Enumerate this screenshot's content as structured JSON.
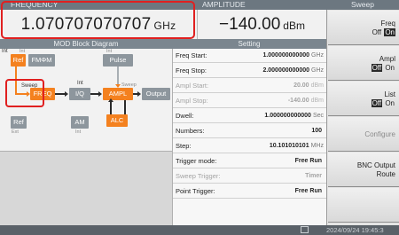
{
  "frequency": {
    "header": "FREQUENCY",
    "value": "1.070707070707",
    "unit": "GHz"
  },
  "amplitude": {
    "header": "AMPLITUDE",
    "value": "−140.00",
    "unit": "dBm"
  },
  "diagram": {
    "title": "MOD Block Diagram",
    "blocks": {
      "ref_top": "Ref",
      "fm_phim": "FMΦM",
      "pulse": "Pulse",
      "freq": "FREQ",
      "iq": "I/Q",
      "ampl": "AMPL",
      "output": "Output",
      "ref_bottom": "Ref",
      "am": "AM",
      "alc": "ALC"
    },
    "labels": {
      "int_fm": "Int",
      "int_pulse": "Int",
      "sweep_freq": "Sweep",
      "sweep_ampl": "Sweep",
      "int_iq": "Int",
      "ext": "Ext",
      "int_am": "Int"
    }
  },
  "setting": {
    "title": "Setting",
    "rows": [
      {
        "label": "Freq Start:",
        "value": "1.000000000000",
        "unit": "GHz"
      },
      {
        "label": "Freq Stop:",
        "value": "2.000000000000",
        "unit": "GHz"
      },
      {
        "label": "Ampl Start:",
        "value": "20.00",
        "unit": "dBm"
      },
      {
        "label": "Ampl Stop:",
        "value": "-140.00",
        "unit": "dBm"
      },
      {
        "label": "Dwell:",
        "value": "1.000000000000",
        "unit": "Sec"
      },
      {
        "label": "Numbers:",
        "value": "100",
        "unit": ""
      },
      {
        "label": "Step:",
        "value": "10.101010101",
        "unit": "MHz"
      },
      {
        "label": "Trigger mode:",
        "value": "Free Run",
        "unit": ""
      },
      {
        "label": "Sweep Trigger:",
        "value": "Timer",
        "unit": ""
      },
      {
        "label": "Point Trigger:",
        "value": "Free Run",
        "unit": ""
      }
    ]
  },
  "softkeys": {
    "title": "Sweep",
    "freq": {
      "label": "Freq",
      "off": "Off",
      "on": "On"
    },
    "ampl": {
      "label": "Ampl",
      "off": "Off",
      "on": "On"
    },
    "list": {
      "label": "List",
      "off": "Off",
      "on": "On"
    },
    "configure": {
      "label": "Configure"
    },
    "bnc": {
      "line1": "BNC Output",
      "line2": "Route"
    }
  },
  "status": {
    "datetime": "2024/09/24 19:45:3"
  }
}
